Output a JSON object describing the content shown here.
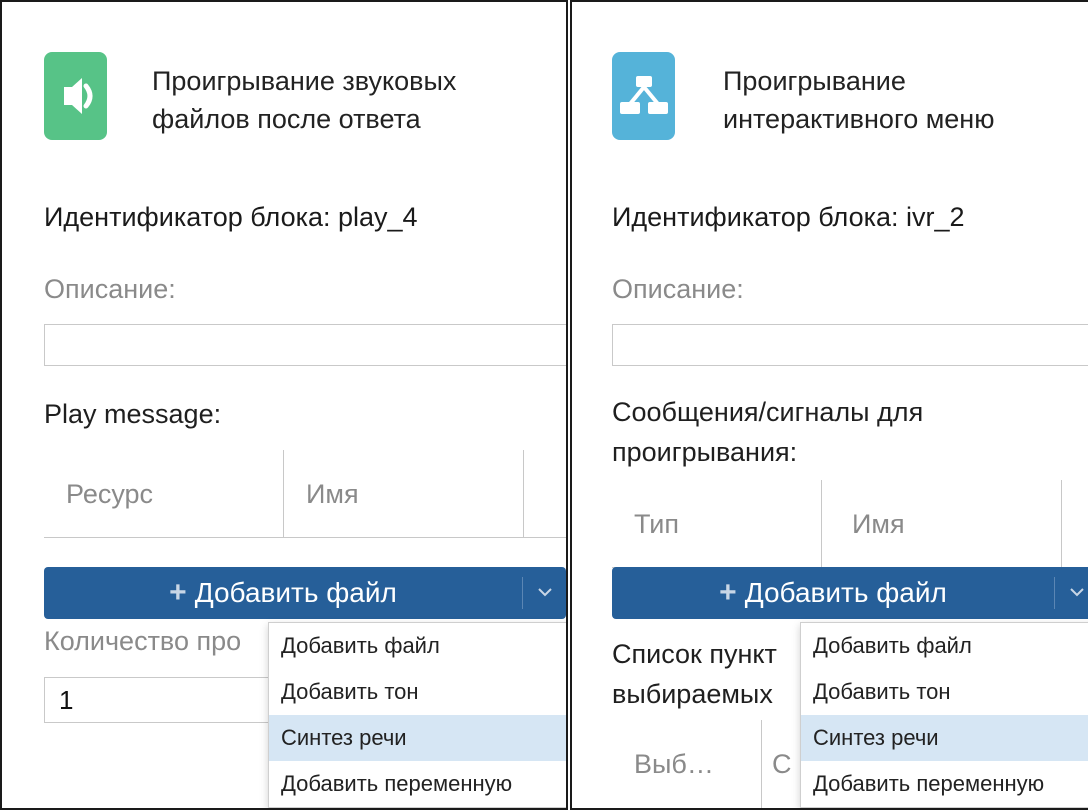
{
  "left_panel": {
    "title_line1": "Проигрывание звуковых",
    "title_line2": "файлов после ответа",
    "block_id": "Идентификатор блока: play_4",
    "description_label": "Описание:",
    "description_value": "",
    "section_label": "Play message:",
    "columns": [
      "Ресурс",
      "Имя"
    ],
    "add_button": {
      "plus": "+",
      "label": "Добавить файл"
    },
    "count_label": "Количество про",
    "count_value": "1",
    "icon_color": "#57c387"
  },
  "right_panel": {
    "title_line1": "Проигрывание",
    "title_line2": "интерактивного меню",
    "block_id": "Идентификатор блока: ivr_2",
    "description_label": "Описание:",
    "description_value": "",
    "section_label_line1": "Сообщения/сигналы для",
    "section_label_line2": "проигрывания:",
    "columns": [
      "Тип",
      "Имя"
    ],
    "add_button": {
      "plus": "+",
      "label": "Добавить файл"
    },
    "list_label_line1": "Список пункт",
    "list_label_line2": "выбираемых",
    "list_columns": [
      "Выб…",
      "С"
    ],
    "icon_color": "#55b3d9"
  },
  "dropdown": {
    "items": [
      "Добавить файл",
      "Добавить тон",
      "Синтез речи",
      "Добавить переменную"
    ],
    "highlighted": "Синтез речи"
  },
  "colors": {
    "button_bg": "#265f99",
    "menu_highlight": "#d6e6f4",
    "border_dark": "#1a1a1a"
  }
}
